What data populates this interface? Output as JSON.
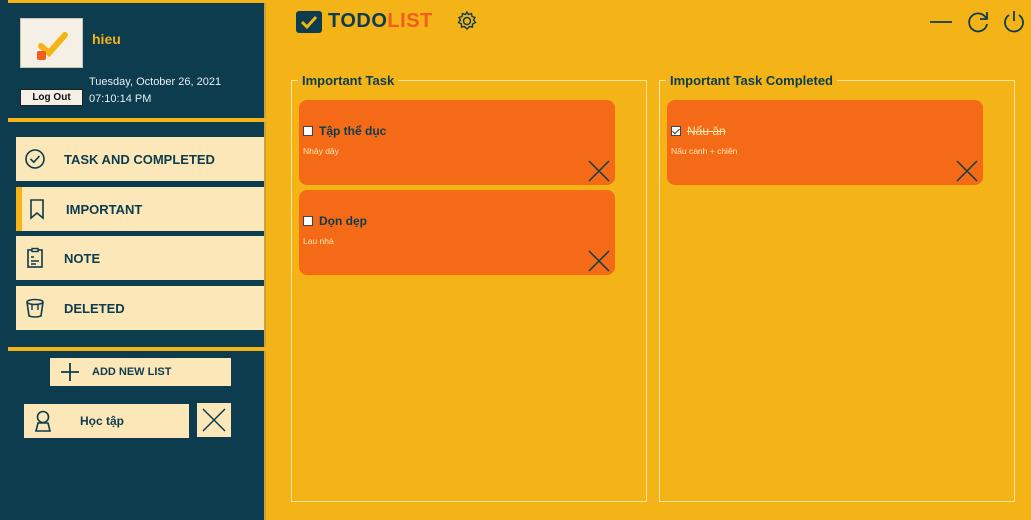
{
  "user": {
    "name": "hieu",
    "logout_label": "Log Out",
    "date": "Tuesday, October 26, 2021",
    "time": "07:10:14 PM"
  },
  "nav": [
    {
      "label": "TASK AND COMPLETED",
      "icon": "check-circle-icon"
    },
    {
      "label": "IMPORTANT",
      "icon": "bookmark-icon"
    },
    {
      "label": "NOTE",
      "icon": "clipboard-icon"
    },
    {
      "label": "DELETED",
      "icon": "trash-icon"
    }
  ],
  "add_list_label": "ADD NEW LIST",
  "lists": [
    {
      "label": "Học tập",
      "icon": "person-icon"
    }
  ],
  "header": {
    "logo_main": "TODO",
    "logo_accent": "LIST"
  },
  "panels": {
    "important": {
      "title": "Important Task",
      "tasks": [
        {
          "title": "Tập thể dục",
          "desc": "Nhảy dây",
          "done": false
        },
        {
          "title": "Dọn dẹp",
          "desc": "Lau nhà",
          "done": false
        }
      ]
    },
    "completed": {
      "title": "Important Task Completed",
      "tasks": [
        {
          "title": "Nấu ăn",
          "desc": "Nấu canh + chiên",
          "done": true
        }
      ]
    }
  },
  "colors": {
    "sidebar": "#0d3c4e",
    "background": "#f4b417",
    "card": "#f56a17",
    "nav_bg": "#fce7b8"
  }
}
